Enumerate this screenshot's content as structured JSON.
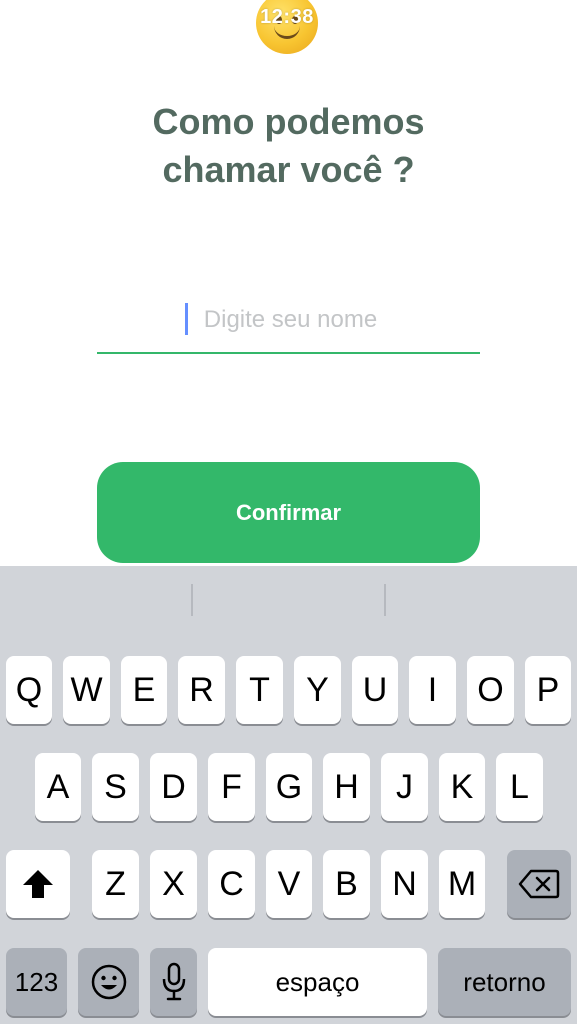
{
  "status_bar": {
    "time": "12:38"
  },
  "page": {
    "title_line1": "Como podemos",
    "title_line2": "chamar você ?"
  },
  "form": {
    "name_input": {
      "placeholder": "Digite seu nome",
      "value": ""
    },
    "confirm_label": "Confirmar"
  },
  "colors": {
    "accent": "#33b86a",
    "title": "#536a60",
    "keyboard_bg": "#d1d4d9"
  },
  "keyboard": {
    "row1": [
      "Q",
      "W",
      "E",
      "R",
      "T",
      "Y",
      "U",
      "I",
      "O",
      "P"
    ],
    "row2": [
      "A",
      "S",
      "D",
      "F",
      "G",
      "H",
      "J",
      "K",
      "L"
    ],
    "row3": [
      "Z",
      "X",
      "C",
      "V",
      "B",
      "N",
      "M"
    ],
    "shift_icon": "shift-arrow-icon",
    "backspace_icon": "backspace-icon",
    "numbers_label": "123",
    "emoji_icon": "smiley-icon",
    "mic_icon": "microphone-icon",
    "space_label": "espaço",
    "return_label": "retorno"
  }
}
